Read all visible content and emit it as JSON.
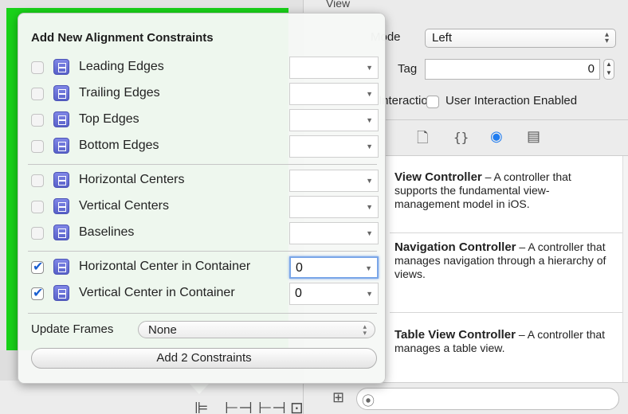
{
  "popover": {
    "title": "Add New Alignment Constraints",
    "rows": [
      {
        "label": "Leading Edges",
        "checked": false,
        "value": "",
        "icon": "leading-edges-icon"
      },
      {
        "label": "Trailing Edges",
        "checked": false,
        "value": "",
        "icon": "trailing-edges-icon"
      },
      {
        "label": "Top Edges",
        "checked": false,
        "value": "",
        "icon": "top-edges-icon"
      },
      {
        "label": "Bottom Edges",
        "checked": false,
        "value": "",
        "icon": "bottom-edges-icon"
      },
      {
        "label": "Horizontal Centers",
        "checked": false,
        "value": "",
        "icon": "horizontal-centers-icon"
      },
      {
        "label": "Vertical Centers",
        "checked": false,
        "value": "",
        "icon": "vertical-centers-icon"
      },
      {
        "label": "Baselines",
        "checked": false,
        "value": "",
        "icon": "baselines-icon"
      },
      {
        "label": "Horizontal Center in Container",
        "checked": true,
        "value": "0",
        "icon": "horizontal-center-container-icon"
      },
      {
        "label": "Vertical Center in Container",
        "checked": true,
        "value": "0",
        "icon": "vertical-center-container-icon"
      }
    ],
    "update_frames_label": "Update Frames",
    "update_frames_value": "None",
    "add_button_label": "Add 2 Constraints"
  },
  "inspector": {
    "view_title": "View",
    "mode_label": "Mode",
    "mode_value": "Left",
    "tag_label": "Tag",
    "tag_value": "0",
    "interaction_label": "Interaction",
    "user_interaction_label": "User Interaction Enabled",
    "tabs": [
      "file-icon",
      "braces-icon",
      "object-library-icon",
      "media-icon"
    ],
    "library": [
      {
        "name": "View Controller",
        "desc": "A controller that supports the fundamental view-management model in iOS."
      },
      {
        "name": "Navigation Controller",
        "desc": "A controller that manages navigation through a hierarchy of views."
      },
      {
        "name": "Table View Controller",
        "desc": "A controller that manages a table view."
      }
    ]
  },
  "colors": {
    "green_view": "#19d219",
    "accent": "#1f7cf0",
    "check": "#1a5fd0",
    "icon_purple": "#5861c9"
  }
}
